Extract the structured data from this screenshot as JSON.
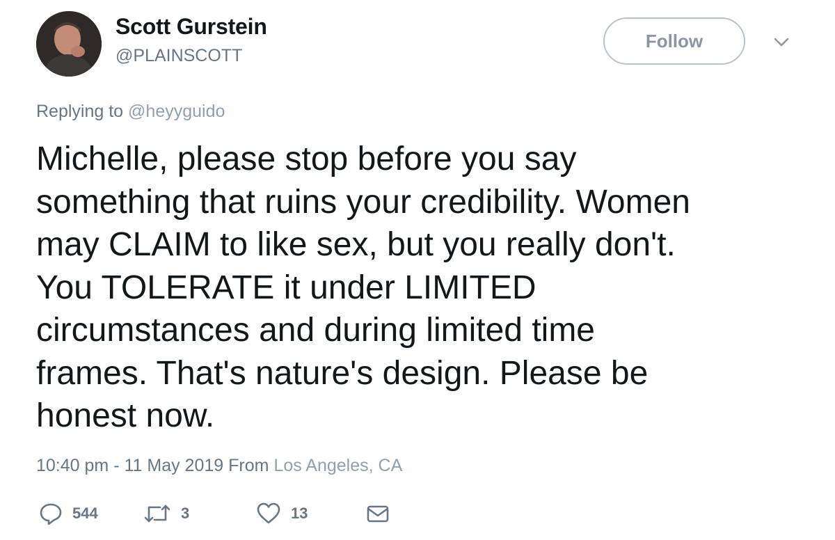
{
  "user": {
    "name": "Scott Gurstein",
    "handle": "@PLAINSCOTT"
  },
  "follow_button": {
    "label": "Follow"
  },
  "reply_context": {
    "prefix": "Replying to",
    "handle": "@heyyguido"
  },
  "tweet": {
    "text": "Michelle, please stop before you say\nsomething that ruins your credibility. Women\nmay CLAIM to like sex, but you really don't.\nYou TOLERATE it under LIMITED\ncircumstances and during limited time\nframes.  That's nature's design.  Please be\nhonest now."
  },
  "meta": {
    "time": "10:40 pm",
    "separator": "-",
    "date": "11 May 2019",
    "from_label": "From",
    "location": "Los Angeles, CA"
  },
  "actions": {
    "replies": "544",
    "retweets": "3",
    "likes": "13"
  },
  "icons": {
    "reply": "reply-icon",
    "retweet": "retweet-icon",
    "like": "heart-icon",
    "dm": "envelope-icon",
    "menu": "chevron-down-icon"
  },
  "colors": {
    "text": "#14171a",
    "secondary": "#657786",
    "link_muted": "#8fa0b0",
    "button_border": "#b8c2cc"
  }
}
